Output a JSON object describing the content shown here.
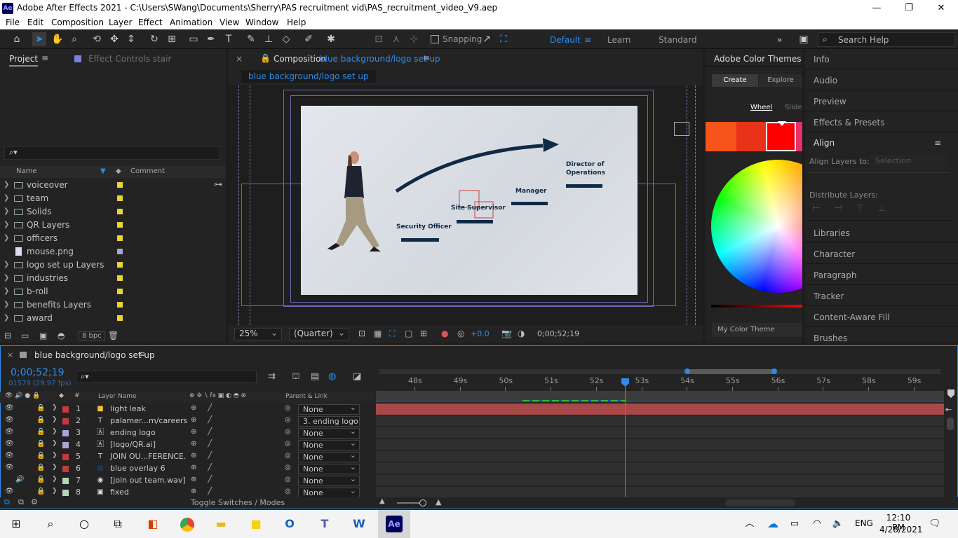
{
  "window": {
    "app_badge": "Ae",
    "title": "Adobe After Effects 2021 - C:\\Users\\SWang\\Documents\\Sherry\\PAS recruitment vid\\PAS_recruitment_video_V9.aep"
  },
  "menu": [
    "File",
    "Edit",
    "Composition",
    "Layer",
    "Effect",
    "Animation",
    "View",
    "Window",
    "Help"
  ],
  "toolbar": {
    "snapping_label": "Snapping",
    "workspaces": [
      "Default",
      "Learn",
      "Standard"
    ],
    "active_workspace": "Default",
    "search_placeholder": "Search Help"
  },
  "project_panel": {
    "tab_project": "Project",
    "tab_effect_controls": "Effect Controls stair",
    "col_name": "Name",
    "col_comment": "Comment",
    "bpc": "8 bpc",
    "items": [
      {
        "name": "voiceover",
        "type": "folder",
        "color": "#e8d634"
      },
      {
        "name": "team",
        "type": "folder",
        "color": "#e8d634"
      },
      {
        "name": "Solids",
        "type": "folder",
        "color": "#e8d634"
      },
      {
        "name": "QR Layers",
        "type": "folder",
        "color": "#e8d634"
      },
      {
        "name": "officers",
        "type": "folder",
        "color": "#e8d634"
      },
      {
        "name": "mouse.png",
        "type": "file",
        "color": "#a9a3d6"
      },
      {
        "name": "logo set up Layers",
        "type": "folder",
        "color": "#e8d634"
      },
      {
        "name": "industries",
        "type": "folder",
        "color": "#e8d634"
      },
      {
        "name": "b-roll",
        "type": "folder",
        "color": "#e8d634"
      },
      {
        "name": "benefits Layers",
        "type": "folder",
        "color": "#e8d634"
      },
      {
        "name": "award",
        "type": "folder",
        "color": "#e8d634"
      }
    ]
  },
  "composition_panel": {
    "tab_prefix": "Composition",
    "comp_name": "blue background/logo set up",
    "breadcrumb": "blue background/logo set up",
    "zoom": "25%",
    "resolution": "(Quarter)",
    "exposure": "+0.0",
    "timecode": "0;00;52;19",
    "canvas_labels": {
      "director": "Director of Operations",
      "manager": "Manager",
      "site_supervisor": "Site Supervisor",
      "security_officer": "Security Officer"
    }
  },
  "color_themes": {
    "title": "Adobe Color Themes",
    "tab_create": "Create",
    "tab_explore": "Explore",
    "mode_wheel": "Wheel",
    "mode_sliders": "Slider",
    "my_theme": "My Color Theme",
    "swatches": [
      "#f5541a",
      "#e83318",
      "#ff0000"
    ]
  },
  "right_panel": {
    "items_top": [
      "Info",
      "Audio",
      "Preview",
      "Effects & Presets"
    ],
    "align_title": "Align",
    "align_layers_to": "Align Layers to:",
    "align_selection": "Selection",
    "distribute_layers": "Distribute Layers:",
    "items_bottom": [
      "Libraries",
      "Character",
      "Paragraph",
      "Tracker",
      "Content-Aware Fill",
      "Brushes"
    ]
  },
  "timeline": {
    "comp_name": "blue background/logo set up",
    "timecode": "0;00;52;19",
    "frame_info": "01579 (29.97 fps)",
    "col_layer_name": "Layer Name",
    "col_parent": "Parent & Link",
    "toggle_label": "Toggle Switches / Modes",
    "ruler": [
      "48s",
      "49s",
      "50s",
      "51s",
      "52s",
      "53s",
      "54s",
      "55s",
      "56s",
      "57s",
      "58s",
      "59s"
    ],
    "layers": [
      {
        "num": "1",
        "name": "light leak",
        "type": "solid",
        "label": "#c43b3b",
        "parent": "None",
        "audio": false
      },
      {
        "num": "2",
        "name": "palamer...m/careers",
        "type": "text",
        "label": "#c43b3b",
        "parent": "3. ending logo",
        "audio": false
      },
      {
        "num": "3",
        "name": "ending logo",
        "type": "ai",
        "label": "#a9a3d6",
        "parent": "None",
        "audio": false
      },
      {
        "num": "4",
        "name": "[logo/QR.ai]",
        "type": "ai",
        "label": "#a9a3d6",
        "parent": "None",
        "audio": false
      },
      {
        "num": "5",
        "name": "JOIN OU...FERENCE.",
        "type": "text",
        "label": "#c43b3b",
        "parent": "None",
        "audio": false
      },
      {
        "num": "6",
        "name": "blue overlay 6",
        "type": "solid",
        "label": "#c43b3b",
        "parent": "None",
        "audio": false
      },
      {
        "num": "7",
        "name": "[join out team.wav]",
        "type": "audio",
        "label": "#b7d4b7",
        "parent": "None",
        "audio": true
      },
      {
        "num": "8",
        "name": "fixed",
        "type": "file",
        "label": "#b7d4b7",
        "parent": "None",
        "audio": false
      }
    ]
  },
  "taskbar": {
    "time": "12:10 PM",
    "date": "4/28/2021",
    "lang": "ENG"
  }
}
